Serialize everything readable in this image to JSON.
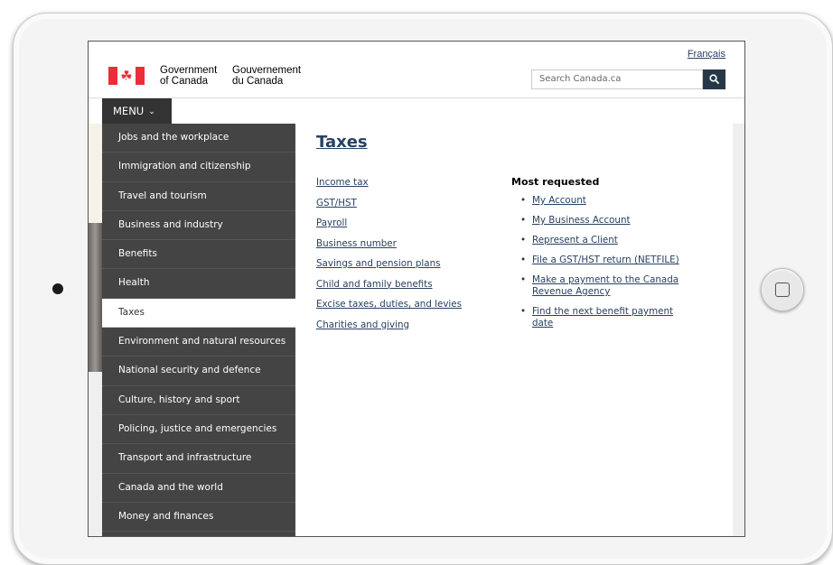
{
  "header": {
    "language_link": "Français",
    "wordmark_en_line1": "Government",
    "wordmark_en_line2": "of Canada",
    "wordmark_fr_line1": "Gouvernement",
    "wordmark_fr_line2": "du Canada",
    "search_placeholder": "Search Canada.ca",
    "search_icon": "magnifier-icon",
    "flag_icon": "maple-leaf-icon"
  },
  "menu": {
    "label": "MENU",
    "chevron": "❯"
  },
  "sidebar": {
    "items": [
      {
        "label": "Jobs and the workplace",
        "active": false
      },
      {
        "label": "Immigration and citizenship",
        "active": false
      },
      {
        "label": "Travel and tourism",
        "active": false
      },
      {
        "label": "Business and industry",
        "active": false
      },
      {
        "label": "Benefits",
        "active": false
      },
      {
        "label": "Health",
        "active": false
      },
      {
        "label": "Taxes",
        "active": true
      },
      {
        "label": "Environment and natural resources",
        "active": false
      },
      {
        "label": "National security and defence",
        "active": false
      },
      {
        "label": "Culture, history and sport",
        "active": false
      },
      {
        "label": "Policing, justice and emergencies",
        "active": false
      },
      {
        "label": "Transport and infrastructure",
        "active": false
      },
      {
        "label": "Canada and the world",
        "active": false
      },
      {
        "label": "Money and finances",
        "active": false
      }
    ]
  },
  "main": {
    "title": "Taxes",
    "links": [
      "Income tax",
      "GST/HST",
      "Payroll",
      "Business number",
      "Savings and pension plans",
      "Child and family benefits",
      "Excise taxes, duties, and levies",
      "Charities and giving"
    ],
    "most_requested_heading": "Most requested",
    "most_requested": [
      {
        "line1": "My Account",
        "line2": ""
      },
      {
        "line1": "My Business Account",
        "line2": ""
      },
      {
        "line1": "Represent a Client",
        "line2": ""
      },
      {
        "line1": "File a GST/HST return (NETFILE)",
        "line2": ""
      },
      {
        "line1": "Make a payment to the Canada",
        "line2": "Revenue Agency"
      },
      {
        "line1": "Find the next benefit payment",
        "line2": "date"
      }
    ],
    "bullet": "•"
  },
  "colors": {
    "link": "#284162",
    "menu_bg": "#444444",
    "flag_red": "#eb2d37",
    "search_button": "#26374a"
  }
}
